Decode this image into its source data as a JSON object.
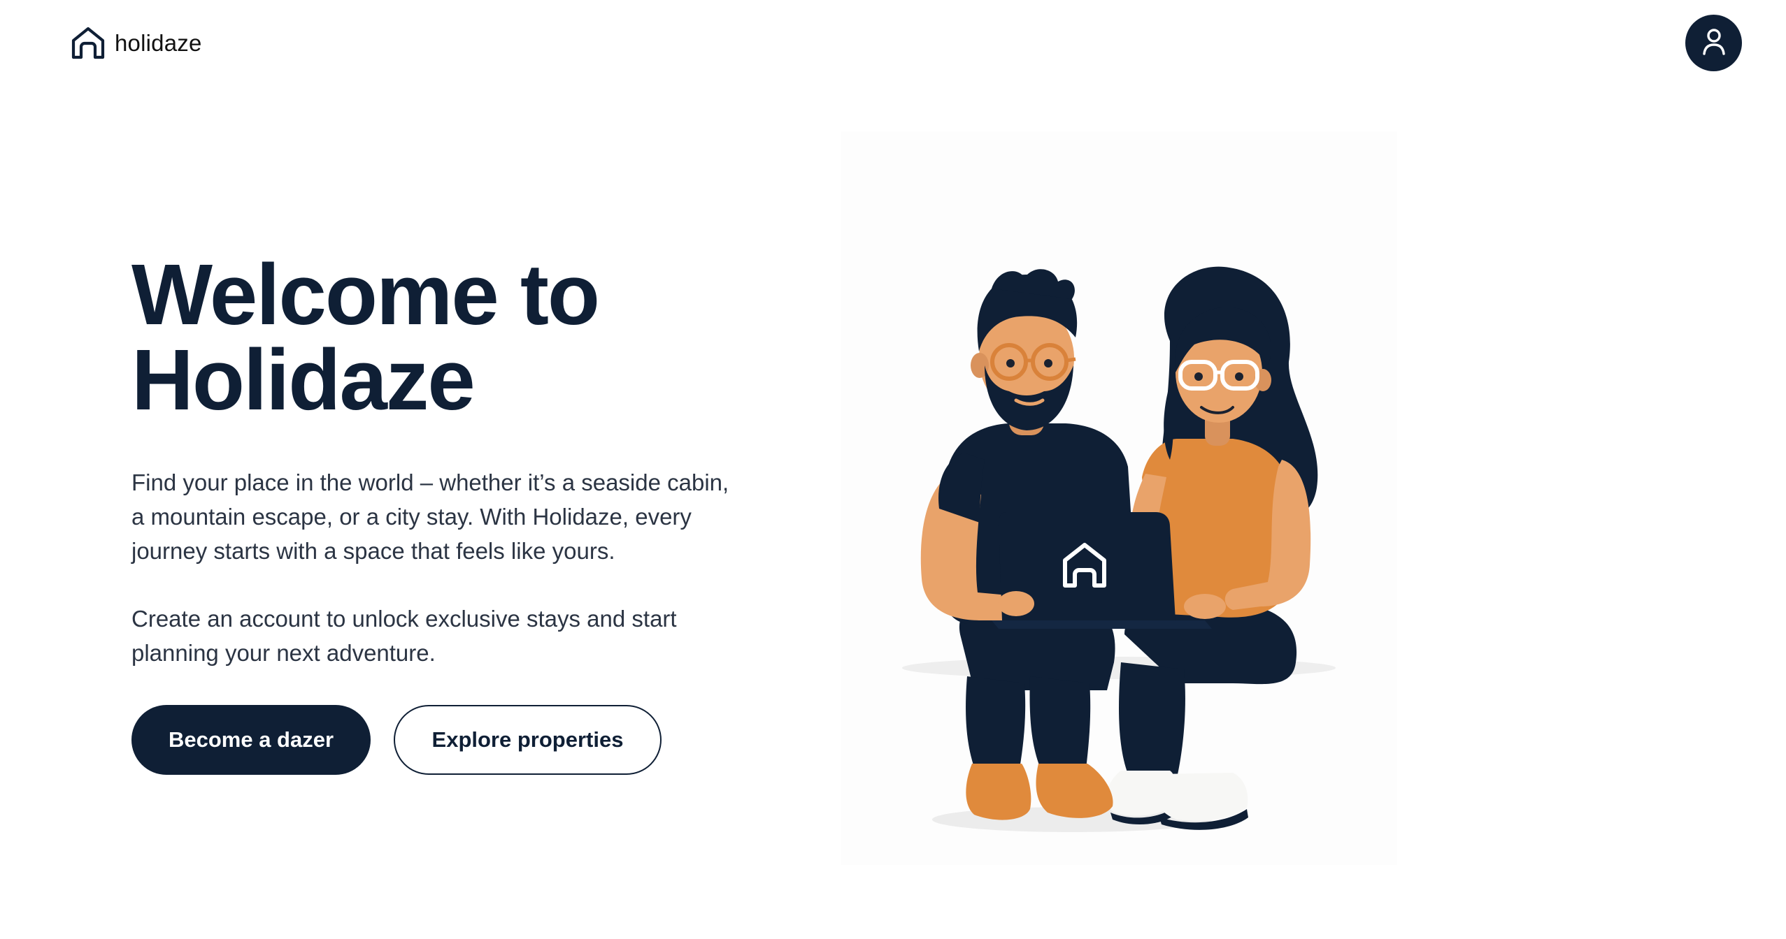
{
  "header": {
    "brand_name": "holidaze",
    "logo_icon": "house-outline-icon",
    "account_icon": "user-icon"
  },
  "hero": {
    "title": "Welcome to Holidaze",
    "body": "Find your place in the world – whether it’s a seaside cabin, a mountain escape, or a city stay. With Holidaze, every journey starts with a space that feels like yours.",
    "body_secondary": "Create an account to unlock exclusive stays and start planning your next adventure.",
    "primary_cta": "Become a dazer",
    "secondary_cta": "Explore properties"
  },
  "illustration": {
    "subject": "couple-with-laptop-illustration",
    "laptop_icon": "house-outline-icon"
  },
  "colors": {
    "navy": "#0f1f35",
    "orange": "#e08a3c",
    "skin": "#e9a36a",
    "text": "#2b3443",
    "background": "#ffffff"
  }
}
